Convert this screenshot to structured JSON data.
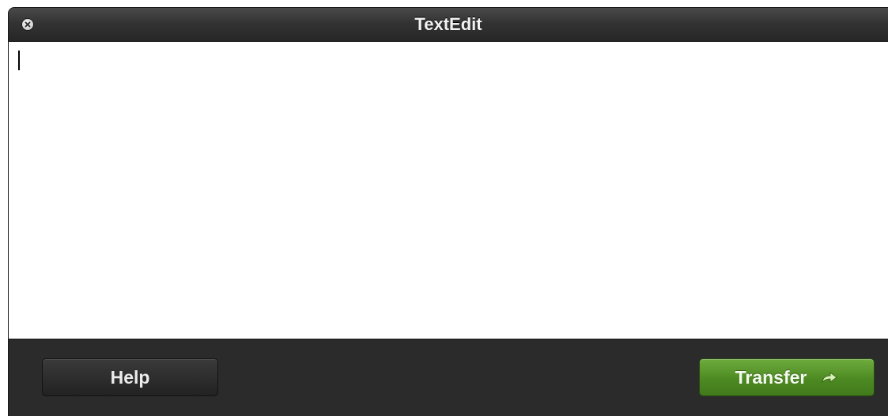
{
  "window": {
    "title": "TextEdit"
  },
  "editor": {
    "content": ""
  },
  "footer": {
    "help_label": "Help",
    "transfer_label": "Transfer"
  },
  "icons": {
    "close": "close-icon",
    "transfer_arrow": "arrow-right-icon"
  },
  "colors": {
    "accent_green": "#4d8a22",
    "titlebar": "#333333",
    "footer": "#2b2b2b"
  }
}
